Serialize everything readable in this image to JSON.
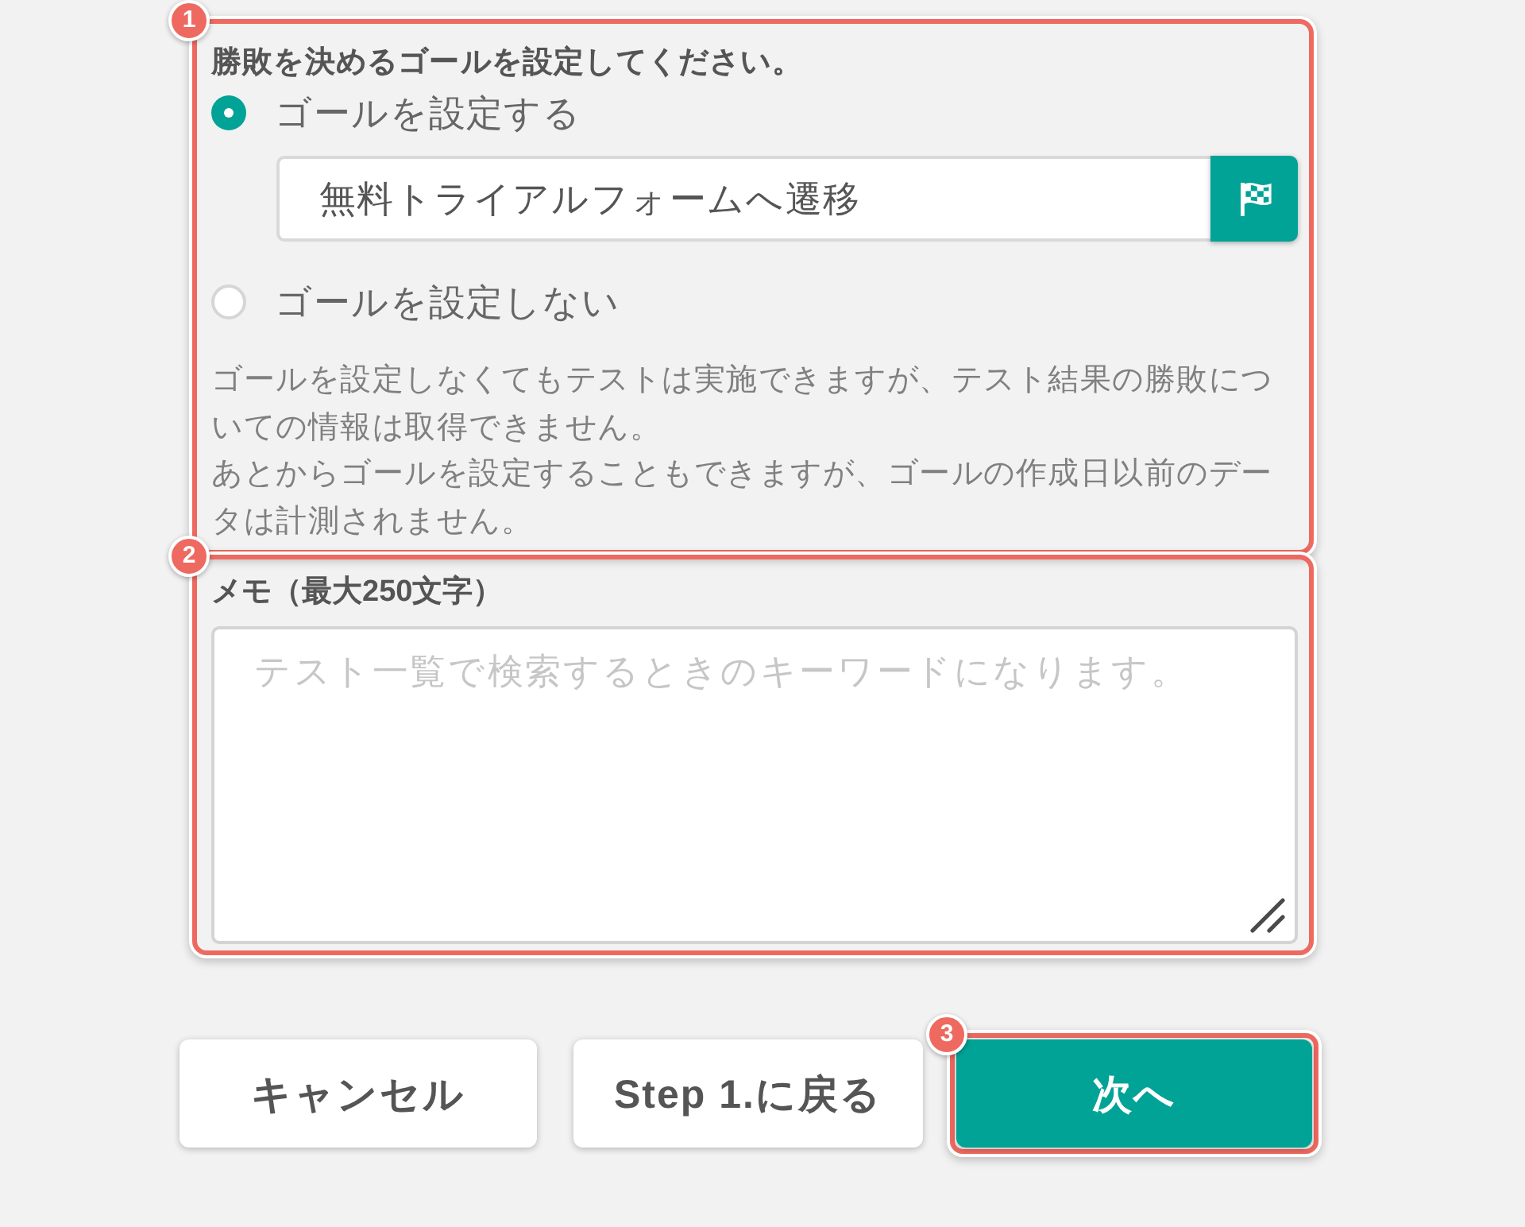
{
  "goal_section": {
    "callout": "1",
    "title": "勝敗を決めるゴールを設定してください。",
    "options": [
      {
        "label": "ゴールを設定する",
        "selected": true,
        "field": {
          "value": "無料トライアルフォームへ遷移"
        }
      },
      {
        "label": "ゴールを設定しない",
        "selected": false
      }
    ],
    "notes": [
      "ゴールを設定しなくてもテストは実施できますが、テスト結果の勝敗についての情報は取得できません。",
      "あとからゴールを設定することもできますが、ゴールの作成日以前のデータは計測されません。"
    ]
  },
  "memo_section": {
    "callout": "2",
    "label": "メモ（最大250文字）",
    "placeholder": "テスト一覧で検索するときのキーワードになります。"
  },
  "buttons": [
    {
      "label": "キャンセル",
      "kind": "secondary"
    },
    {
      "label": "Step 1.に戻る",
      "kind": "secondary"
    },
    {
      "label": "次へ",
      "kind": "primary",
      "callout": "3"
    }
  ]
}
